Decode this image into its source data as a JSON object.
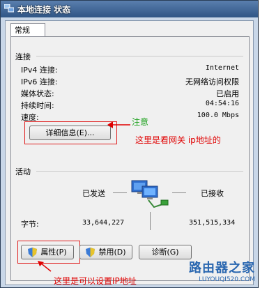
{
  "window": {
    "title": "本地连接 状态"
  },
  "tabs": [
    {
      "label": "常规"
    }
  ],
  "connection": {
    "group_label": "连接",
    "rows": [
      {
        "label": "IPv4 连接:",
        "value": "Internet"
      },
      {
        "label": "IPv6 连接:",
        "value": "无网络访问权限"
      },
      {
        "label": "媒体状态:",
        "value": "已启用"
      },
      {
        "label": "持续时间:",
        "value": "04:54:16"
      },
      {
        "label": "速度:",
        "value": "100.0 Mbps"
      }
    ],
    "details_button": "详细信息(E)..."
  },
  "activity": {
    "group_label": "活动",
    "sent_label": "已发送",
    "received_label": "已接收",
    "bytes_label": "字节:",
    "bytes_sent": "33,644,227",
    "bytes_received": "351,515,334"
  },
  "buttons": {
    "properties": "属性(P)",
    "disable": "禁用(D)",
    "diagnose": "诊断(G)"
  },
  "annotations": {
    "note": "注意",
    "details_hint": "这里是看网关 ip地址的",
    "properties_hint": "这里是可以设置IP地址"
  },
  "watermark": {
    "main": "路由器之家",
    "sub": "LUYOUQI520.COM"
  },
  "colors": {
    "title_bar": "#3a5f90",
    "annotation_red": "#e00000",
    "annotation_green": "#1aa01a"
  }
}
